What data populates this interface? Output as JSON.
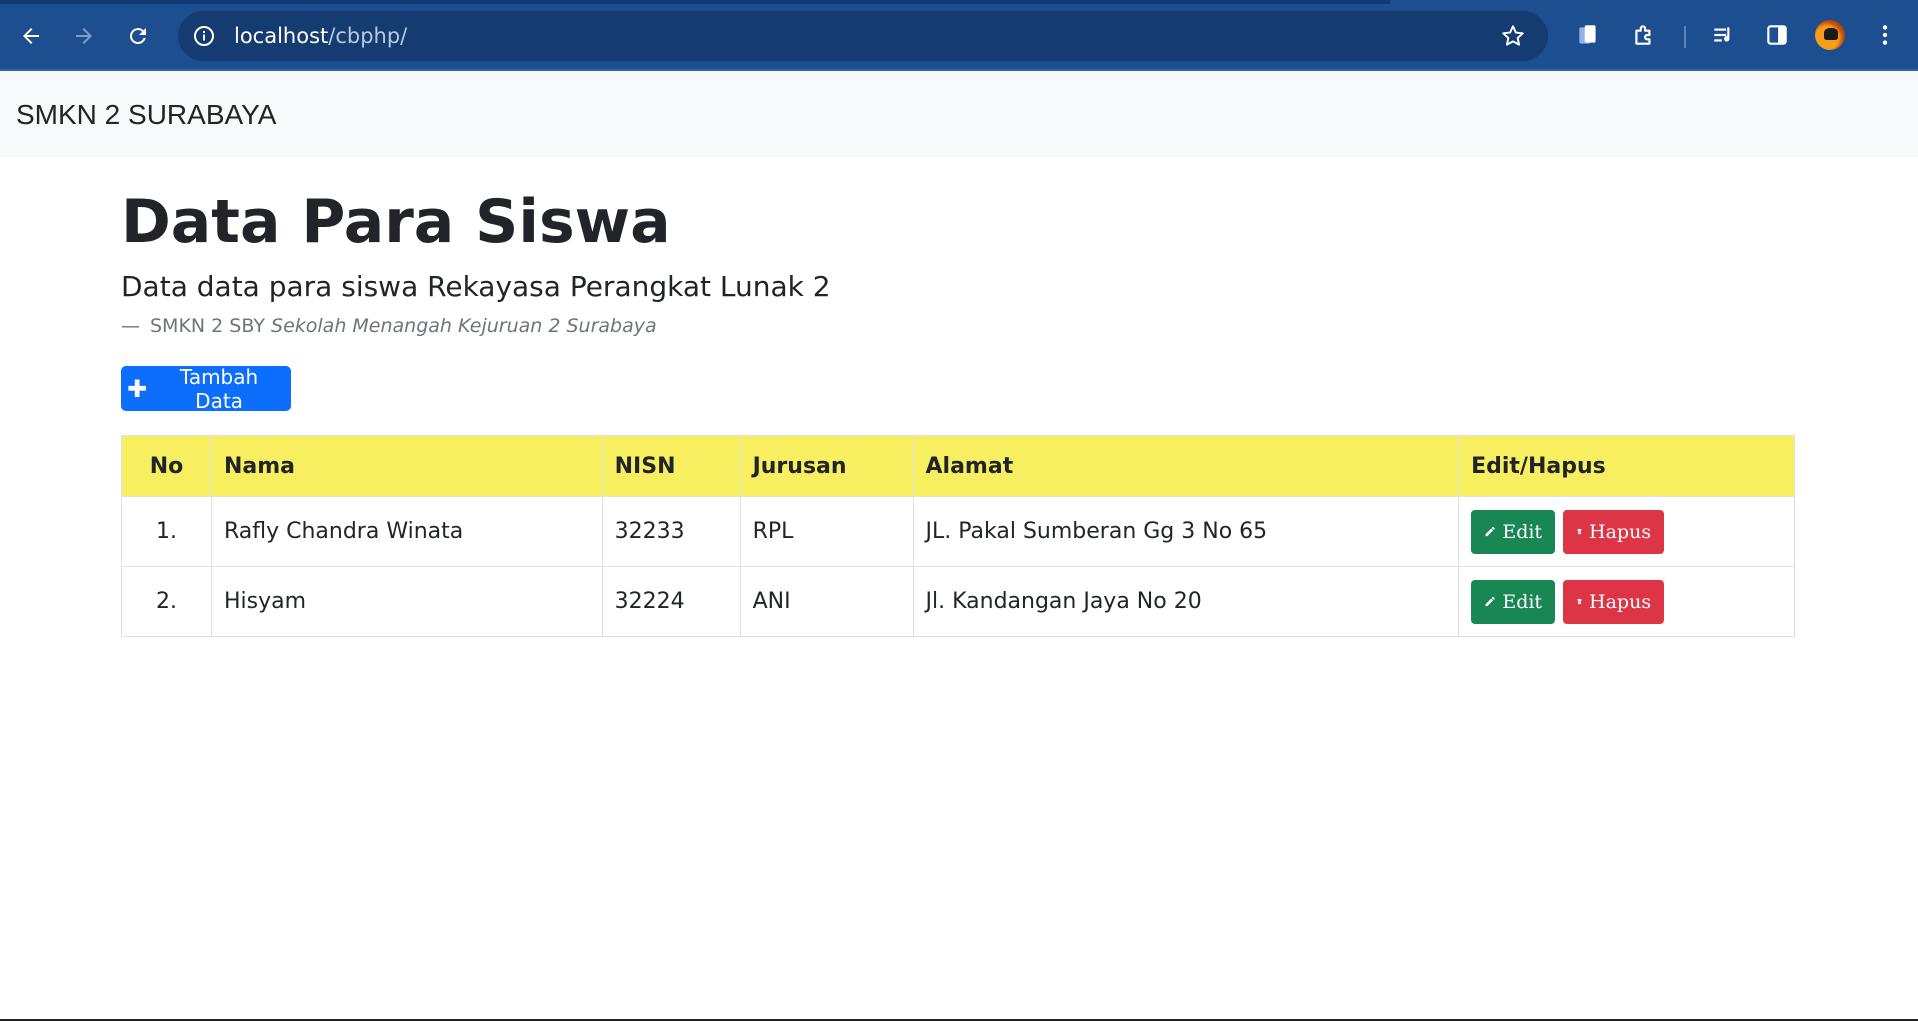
{
  "browser": {
    "url_host": "localhost",
    "url_path": "/cbphp/"
  },
  "navbar": {
    "brand": "SMKN 2 SURABAYA"
  },
  "page": {
    "title": "Data Para Siswa",
    "lead": "Data data para siswa Rekayasa Perangkat Lunak 2",
    "footer_dash": "—",
    "footer_source": "SMKN 2 SBY",
    "footer_cite": "Sekolah Menangah Kejuruan 2 Surabaya",
    "add_button": "Tambah Data"
  },
  "table": {
    "headers": {
      "no": "No",
      "nama": "Nama",
      "nisn": "NISN",
      "jurusan": "Jurusan",
      "alamat": "Alamat",
      "aksi": "Edit/Hapus"
    },
    "rows": [
      {
        "no": "1.",
        "nama": "Rafly Chandra Winata",
        "nisn": "32233",
        "jurusan": "RPL",
        "alamat": "JL. Pakal Sumberan Gg 3 No 65",
        "edit": "Edit",
        "hapus": "Hapus"
      },
      {
        "no": "2.",
        "nama": "Hisyam",
        "nisn": "32224",
        "jurusan": "ANI",
        "alamat": "Jl. Kandangan Jaya No 20",
        "edit": "Edit",
        "hapus": "Hapus"
      }
    ]
  },
  "colors": {
    "browser_bar": "#1d4e8f",
    "primary": "#0d6efd",
    "success": "#198754",
    "danger": "#dc3545",
    "table_header": "#f8ef60"
  },
  "icons": {
    "back": "arrow-left-icon",
    "forward": "arrow-right-icon",
    "reload": "reload-icon",
    "site_info": "info-icon",
    "bookmark": "star-icon",
    "add": "plus-icon",
    "edit": "pencil-icon",
    "delete": "trash-icon"
  }
}
